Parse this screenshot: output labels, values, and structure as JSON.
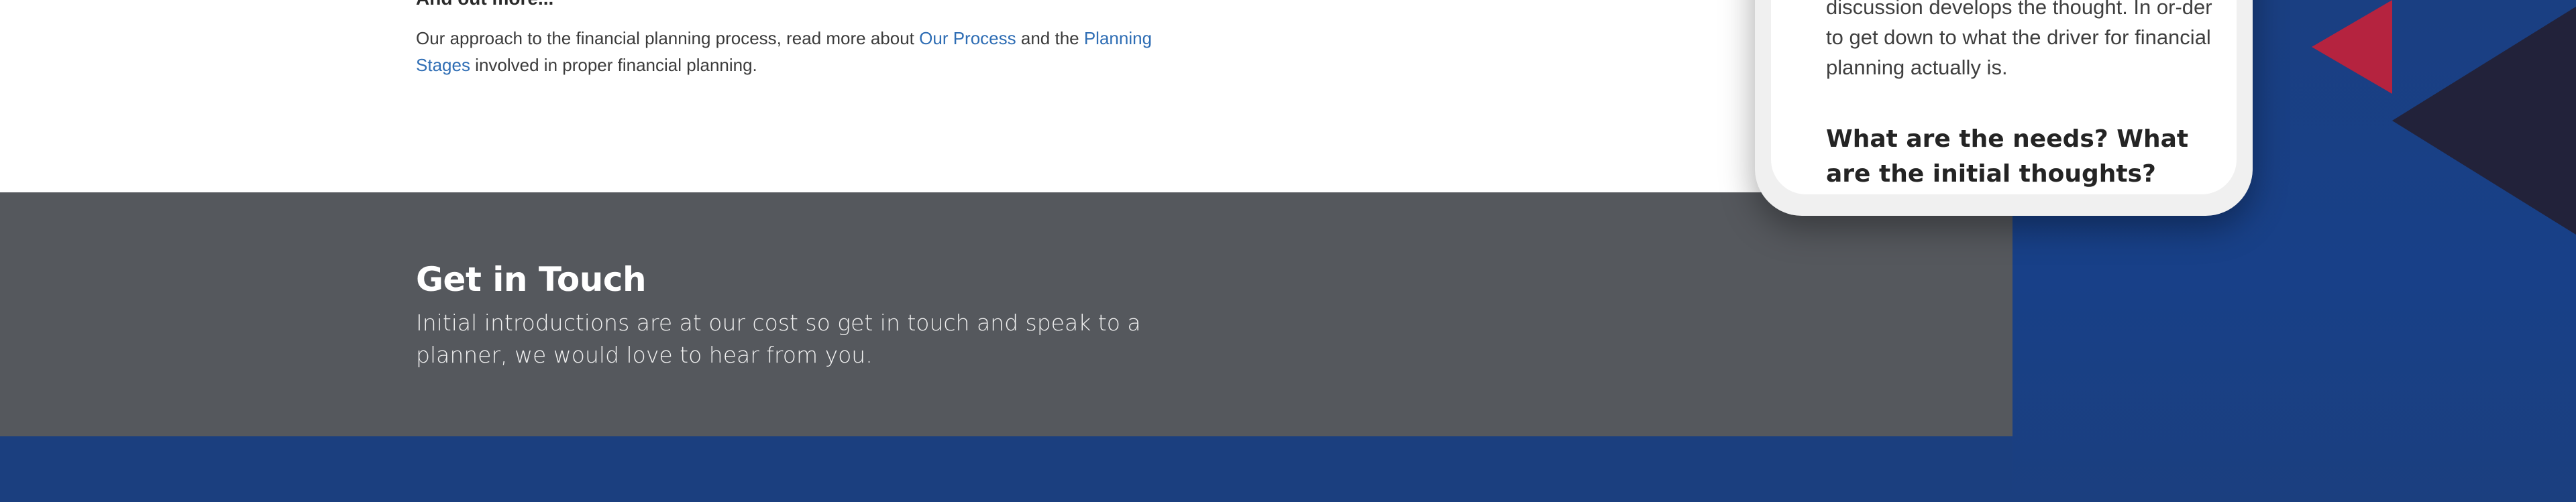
{
  "intro": {
    "heading": "And out more...",
    "text_before": "Our approach to the financial planning process, read more about ",
    "link_process": "Our Process",
    "text_middle": " and the ",
    "link_stages": "Planning Stages",
    "text_after": " involved in proper financial planning."
  },
  "contact": {
    "title": "Get in Touch",
    "text": "Initial introductions are at our cost so get in touch and speak to a planner, we would love to hear from you."
  },
  "phone": {
    "body_text": "discussion develops the thought. In or-der to get down to what the driver for financial planning actually is.",
    "heading": "What are the needs? What are the initial thoughts?"
  },
  "colors": {
    "brand_blue": "#1b3f7f",
    "accent_red": "#b5233f",
    "dark_navy": "#22223a",
    "band_gray": "#55585d",
    "link_blue": "#2e6db4"
  }
}
